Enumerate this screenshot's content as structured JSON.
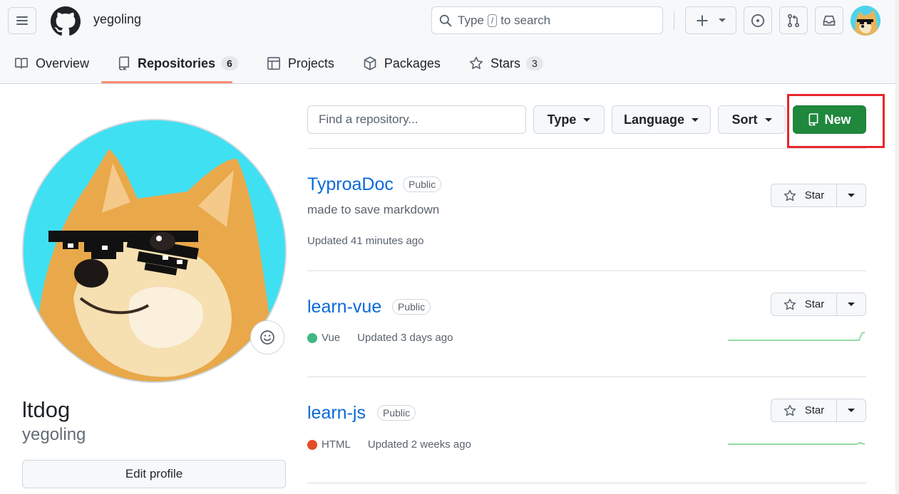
{
  "header": {
    "username": "yegoling",
    "search_prefix": "Type",
    "search_key": "/",
    "search_suffix": "to search"
  },
  "tabs": [
    {
      "label": "Overview",
      "icon": "book-icon"
    },
    {
      "label": "Repositories",
      "icon": "repo-icon",
      "count": "6"
    },
    {
      "label": "Projects",
      "icon": "table-icon"
    },
    {
      "label": "Packages",
      "icon": "package-icon"
    },
    {
      "label": "Stars",
      "icon": "star-icon",
      "count": "3"
    }
  ],
  "profile": {
    "name": "ltdog",
    "login": "yegoling",
    "edit_label": "Edit profile"
  },
  "filters": {
    "find_placeholder": "Find a repository...",
    "type_label": "Type",
    "language_label": "Language",
    "sort_label": "Sort",
    "new_label": "New"
  },
  "repos": [
    {
      "name": "TyproaDoc",
      "visibility": "Public",
      "description": "made to save markdown",
      "language": "",
      "updated": "Updated 41 minutes ago",
      "star_label": "Star"
    },
    {
      "name": "learn-vue",
      "visibility": "Public",
      "description": "",
      "language": "Vue",
      "language_color": "#41b883",
      "updated": "Updated 3 days ago",
      "star_label": "Star"
    },
    {
      "name": "learn-js",
      "visibility": "Public",
      "description": "",
      "language": "HTML",
      "language_color": "#e34c26",
      "updated": "Updated 2 weeks ago",
      "star_label": "Star"
    }
  ],
  "colors": {
    "primary_button": "#1f883d",
    "link": "#0969da",
    "active_tab_underline": "#fd8c73",
    "highlight": "#e8262c"
  }
}
